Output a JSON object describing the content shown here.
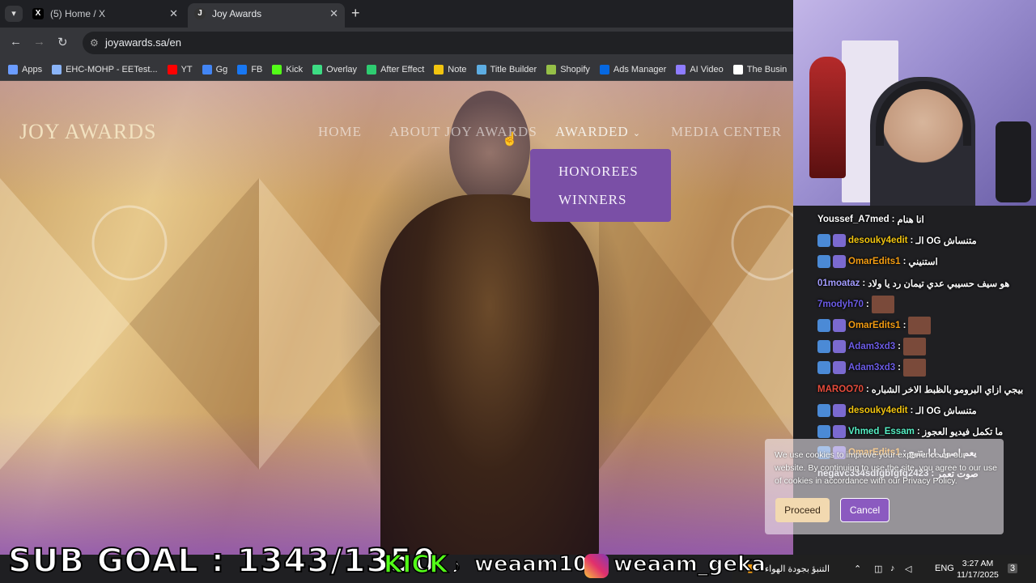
{
  "browser": {
    "tabs": [
      {
        "title": "(5) Home / X",
        "favicon": "x-logo-icon"
      },
      {
        "title": "Joy Awards",
        "favicon": "joy-awards-icon",
        "active": true
      }
    ],
    "url": "joyawards.sa/en",
    "bookmarks": [
      {
        "label": "Apps",
        "icon": "apps-icon",
        "color": "#6b9cff"
      },
      {
        "label": "EHC-MOHP - EETest...",
        "icon": "globe-icon",
        "color": "#8ab4f8"
      },
      {
        "label": "YT",
        "icon": "youtube-icon",
        "color": "#ff0000"
      },
      {
        "label": "Gg",
        "icon": "google-icon",
        "color": "#4285f4"
      },
      {
        "label": "FB",
        "icon": "facebook-icon",
        "color": "#1877f2"
      },
      {
        "label": "Kick",
        "icon": "kick-icon",
        "color": "#53fc18"
      },
      {
        "label": "Overlay",
        "icon": "overlay-icon",
        "color": "#3ddc84"
      },
      {
        "label": "After Effect",
        "icon": "fx-icon",
        "color": "#2ecc71"
      },
      {
        "label": "Note",
        "icon": "note-icon",
        "color": "#f1c40f"
      },
      {
        "label": "Title Builder",
        "icon": "title-builder-icon",
        "color": "#5dade2"
      },
      {
        "label": "Shopify",
        "icon": "shopify-icon",
        "color": "#95bf47"
      },
      {
        "label": "Ads Manager",
        "icon": "meta-icon",
        "color": "#0668e1"
      },
      {
        "label": "AI Video",
        "icon": "ai-video-icon",
        "color": "#8e7cff"
      },
      {
        "label": "The Busin",
        "icon": "business-icon",
        "color": "#ffffff"
      }
    ]
  },
  "site": {
    "logo": "JOY AWARDS",
    "nav": [
      {
        "label": "HOME"
      },
      {
        "label": "ABOUT JOY AWARDS"
      },
      {
        "label": "AWARDED",
        "active": true
      },
      {
        "label": "MEDIA CENTER"
      }
    ],
    "dropdown": [
      "HONOREES",
      "WINNERS"
    ],
    "cookie": {
      "text": "We use cookies to improve your experience on our website. By continuing to use the site, you agree to our use of cookies in accordance with our Privacy Policy.",
      "proceed": "Proceed",
      "cancel": "Cancel"
    }
  },
  "chat": [
    {
      "user": "Youssef_A7med",
      "text": "انا هنام",
      "color": "#ffffff"
    },
    {
      "user": "desouky4edit",
      "text": "الـ OG متنساش",
      "color": "#f1c40f",
      "badge": true
    },
    {
      "user": "OmarEdits1",
      "text": "استنيني",
      "color": "#f39c12",
      "badge": true
    },
    {
      "user": "01moataz",
      "text": "هو سيف حسيبي عدي تيمان رد يا ولاد",
      "color": "#a29bfe"
    },
    {
      "user": "7modyh70",
      "text": "",
      "color": "#6c5ce7",
      "emote": true
    },
    {
      "user": "OmarEdits1",
      "text": "",
      "color": "#f39c12",
      "badge": true,
      "emote": true
    },
    {
      "user": "Adam3xd3",
      "text": "",
      "color": "#6c5ce7",
      "badge": true,
      "emote": true
    },
    {
      "user": "Adam3xd3",
      "text": "",
      "color": "#6c5ce7",
      "badge": true,
      "emote": true
    },
    {
      "user": "MAROO70",
      "text": "بيجي ازاي البرومو بالظبط الاخر الشباره",
      "color": "#e74c3c"
    },
    {
      "user": "desouky4edit",
      "text": "الـ OG متنساش",
      "color": "#f1c40f",
      "badge": true
    },
    {
      "user": "Vhmed_Essam",
      "text": "ما تكمل فيديو العجوز",
      "color": "#55efc4",
      "badge": true
    },
    {
      "user": "OmarEdits1",
      "text": "يعم اصول ابا يتنيح",
      "color": "#f39c12",
      "badge": true
    },
    {
      "user": "negavc334sdfgbfgfg2423",
      "text": "صوت تعمر",
      "color": "#dfe6e9"
    }
  ],
  "overlay": {
    "subgoal": "SUB GOAL : 1343/1350",
    "kick": "KICK",
    "tiktok_handle": "weaam100",
    "instagram_handle": "weaam_geka"
  },
  "taskbar": {
    "weather": "التنبؤ بجودة الهواء",
    "language": "ENG",
    "time": "3:27 AM",
    "date": "11/17/2025",
    "notifications": "3"
  }
}
